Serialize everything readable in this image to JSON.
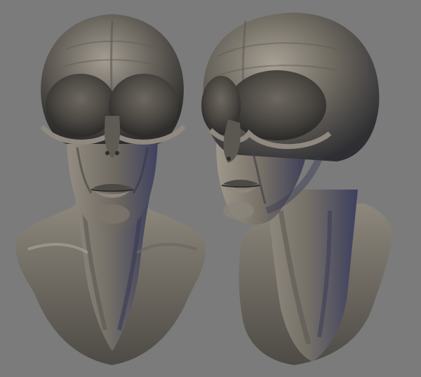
{
  "scene": {
    "background_color": "#7b7b7b",
    "subject": "alien-head-sculpt",
    "views": [
      {
        "id": "front",
        "label": ""
      },
      {
        "id": "three-quarter",
        "label": ""
      }
    ],
    "colors": {
      "skin_mid": "#6b675f",
      "skin_light": "#a59f94",
      "skin_dark": "#34322f",
      "shadow_blue": "#3f4368"
    }
  }
}
